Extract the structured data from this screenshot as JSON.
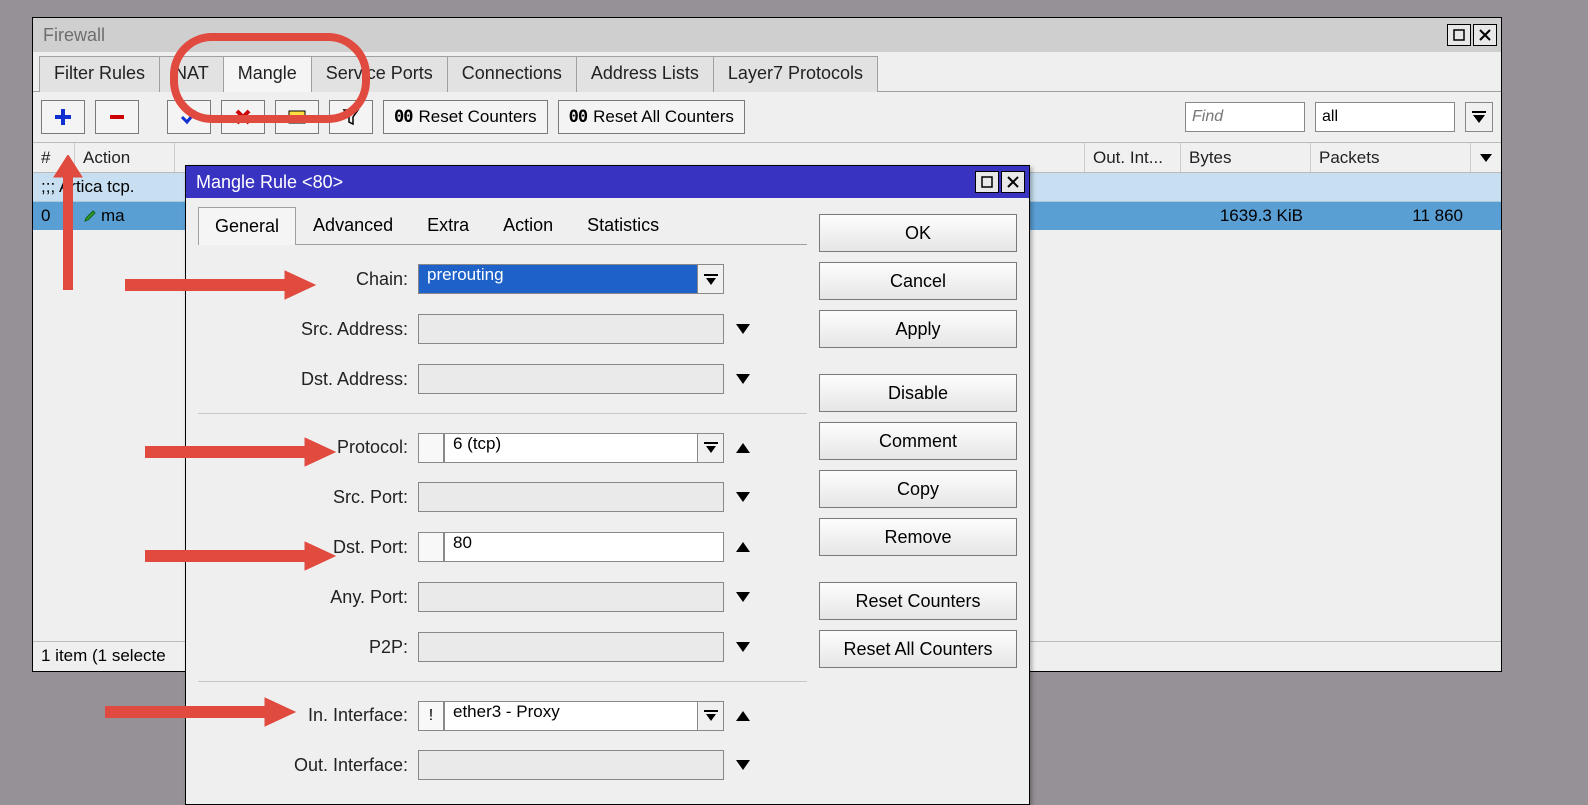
{
  "firewall": {
    "title": "Firewall",
    "tabs": [
      "Filter Rules",
      "NAT",
      "Mangle",
      "Service Ports",
      "Connections",
      "Address Lists",
      "Layer7 Protocols"
    ],
    "active_tab_index": 2,
    "toolbar": {
      "reset_counters": "Reset Counters",
      "reset_all_counters": "Reset All Counters",
      "search_placeholder": "Find",
      "filter_value": "all"
    },
    "columns": {
      "sharp": "#",
      "action": "Action",
      "outint": "Out. Int...",
      "bytes": "Bytes",
      "packets": "Packets"
    },
    "comment_row": ";;; Artica tcp.",
    "row": {
      "index": "0",
      "action_text": "ma",
      "bytes": "1639.3 KiB",
      "packets": "11 860"
    },
    "status": "1 item (1 selecte"
  },
  "dialog": {
    "title": "Mangle Rule <80>",
    "tabs": [
      "General",
      "Advanced",
      "Extra",
      "Action",
      "Statistics"
    ],
    "active_tab_index": 0,
    "fields": {
      "chain": {
        "label": "Chain:",
        "value": "prerouting"
      },
      "src_address": {
        "label": "Src. Address:",
        "value": ""
      },
      "dst_address": {
        "label": "Dst. Address:",
        "value": ""
      },
      "protocol": {
        "label": "Protocol:",
        "value": "6 (tcp)"
      },
      "src_port": {
        "label": "Src. Port:",
        "value": ""
      },
      "dst_port": {
        "label": "Dst. Port:",
        "value": "80"
      },
      "any_port": {
        "label": "Any. Port:",
        "value": ""
      },
      "p2p": {
        "label": "P2P:",
        "value": ""
      },
      "in_interface": {
        "label": "In. Interface:",
        "value": "ether3 - Proxy",
        "negated_mark": "!"
      },
      "out_interface": {
        "label": "Out. Interface:",
        "value": ""
      }
    },
    "buttons": [
      "OK",
      "Cancel",
      "Apply",
      "Disable",
      "Comment",
      "Copy",
      "Remove",
      "Reset Counters",
      "Reset All Counters"
    ]
  }
}
